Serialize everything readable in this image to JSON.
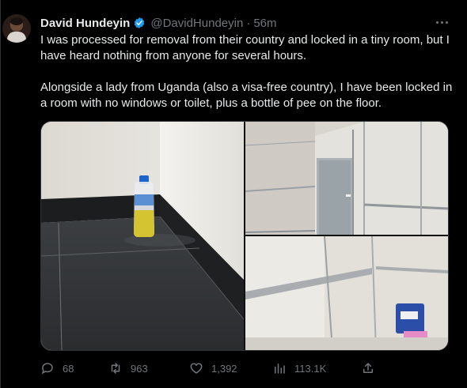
{
  "author": {
    "name": "David Hundeyin",
    "handle": "@DavidHundeyin",
    "separator": "·",
    "time": "56m",
    "verified_color": "#1d9bf0"
  },
  "tweet": {
    "paragraph1": "I was processed for removal from their country and locked in a tiny room, but I have heard nothing from anyone for several hours.",
    "paragraph2": "Alongside a lady from Uganda (also a visa-free country), I have been locked in a room with no windows or toilet, plus a bottle of pee on the floor."
  },
  "media": {
    "images": [
      {
        "name": "floor-corner-with-bottle"
      },
      {
        "name": "room-door"
      },
      {
        "name": "room-walls"
      }
    ]
  },
  "actions": {
    "reply_count": "68",
    "retweet_count": "963",
    "like_count": "1,392",
    "view_count": "113.1K",
    "icons": [
      "reply-icon",
      "retweet-icon",
      "like-icon",
      "views-icon",
      "share-icon"
    ]
  },
  "colors": {
    "background": "#000000",
    "text": "#e7e9ea",
    "muted": "#71767b",
    "accent": "#1d9bf0"
  }
}
